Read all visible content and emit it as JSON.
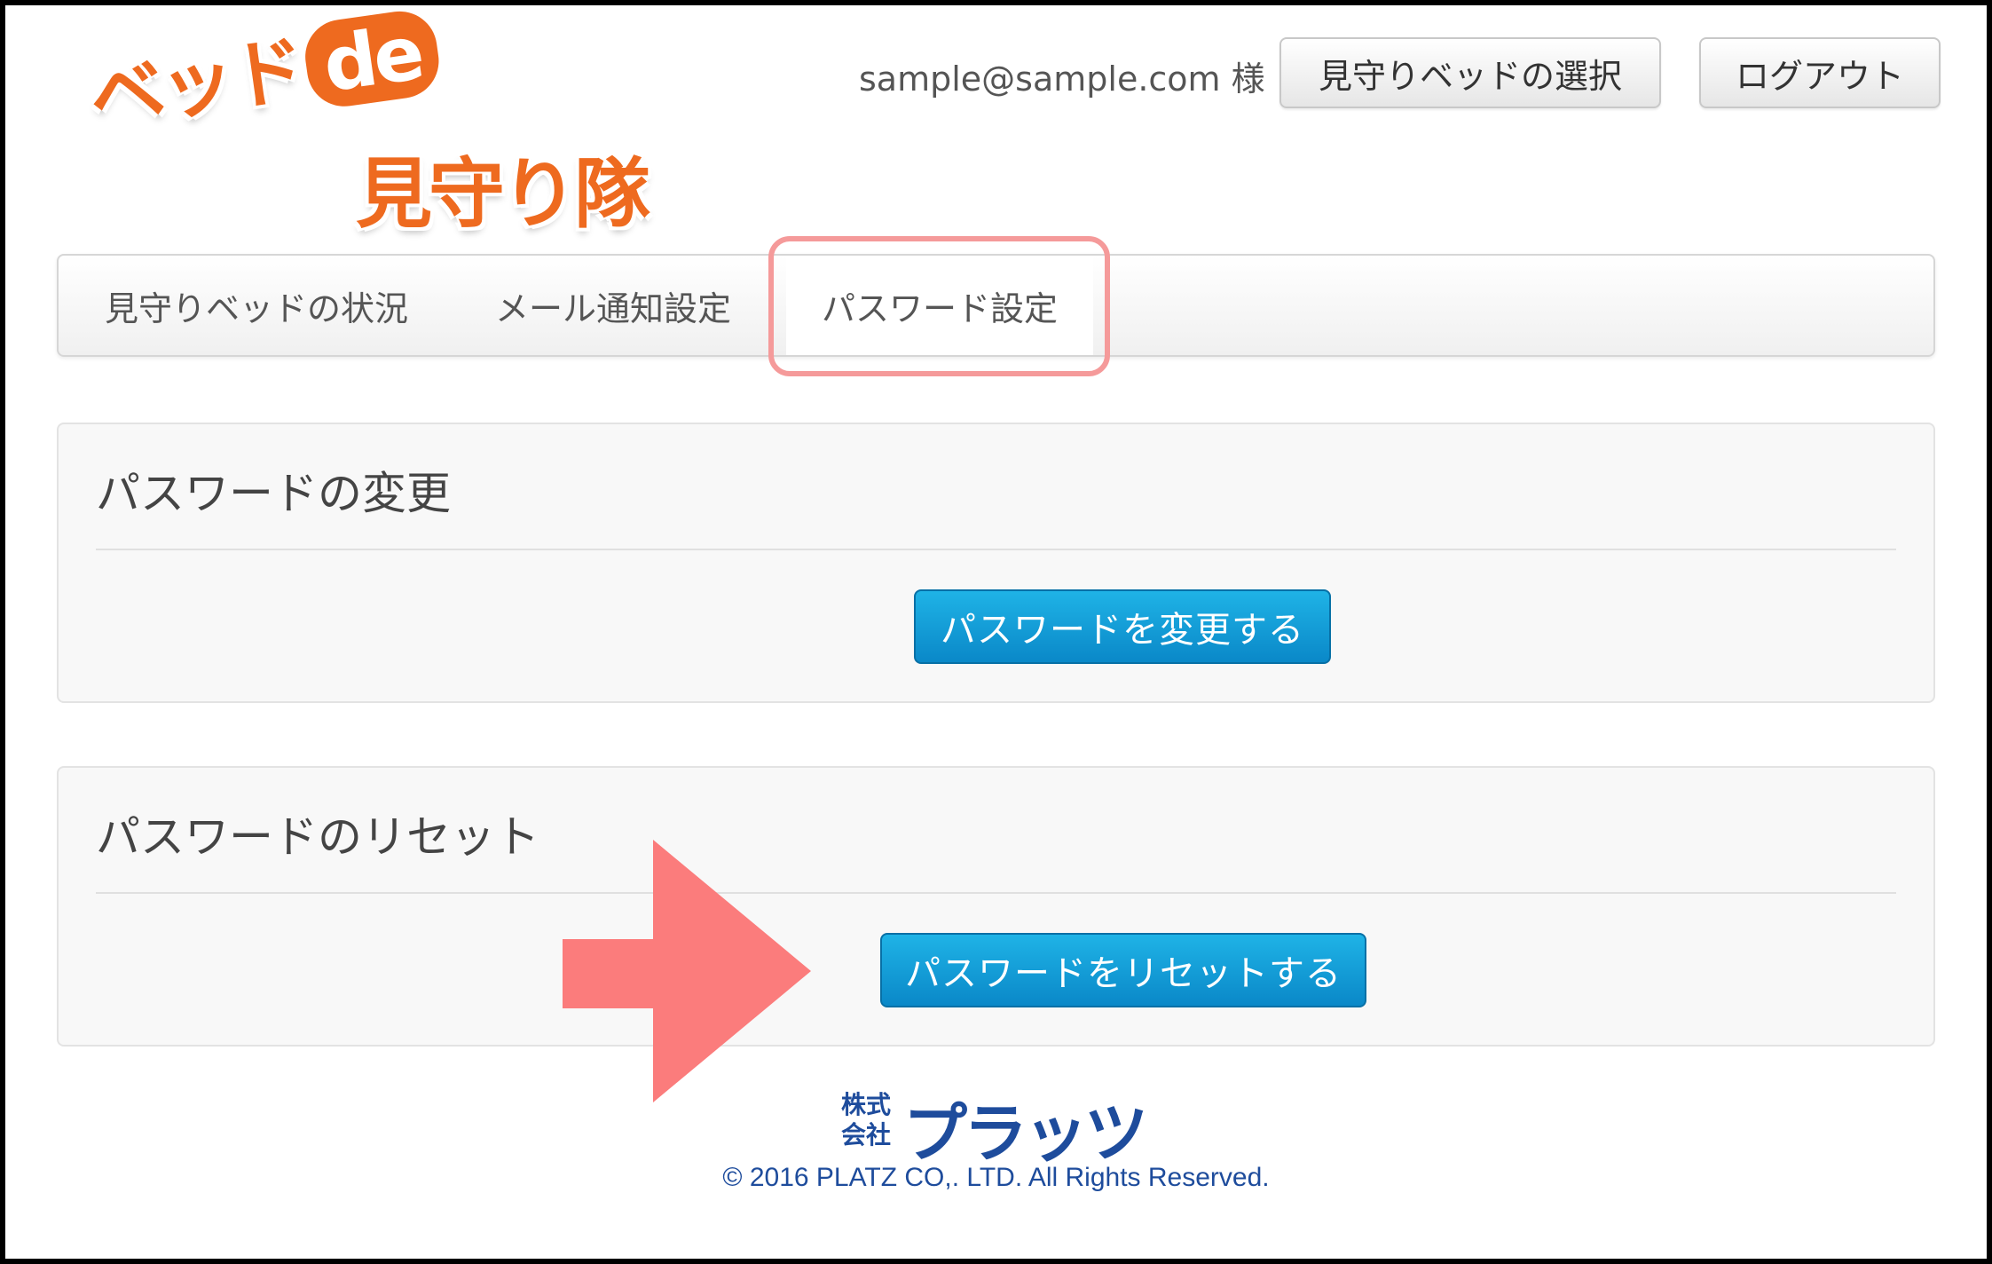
{
  "header": {
    "logo": {
      "line1": "ベッド",
      "line1_badge": "de",
      "line2": "見守り隊"
    },
    "user_label": "sample@sample.com 様",
    "bed_select_label": "見守りベッドの選択",
    "logout_label": "ログアウト"
  },
  "nav": {
    "tabs": [
      {
        "label": "見守りベッドの状況"
      },
      {
        "label": "メール通知設定"
      },
      {
        "label": "パスワード設定",
        "active": true
      }
    ]
  },
  "panels": {
    "change": {
      "title": "パスワードの変更",
      "button_label": "パスワードを変更する"
    },
    "reset": {
      "title": "パスワードのリセット",
      "button_label": "パスワードをリセットする"
    }
  },
  "footer": {
    "company_prefix_top": "株式",
    "company_prefix_bottom": "会社",
    "company_name": "プラッツ",
    "copyright": "© 2016 PLATZ CO,. LTD. All Rights Reserved."
  },
  "colors": {
    "accent_orange": "#ee6a1f",
    "primary_blue": "#0a88c8",
    "highlight_pink": "#f59a9a",
    "arrow_pink": "#fb7c7c",
    "footer_blue": "#1e4c9c"
  },
  "icons": {
    "annotation_arrow": "arrow-right-icon"
  }
}
